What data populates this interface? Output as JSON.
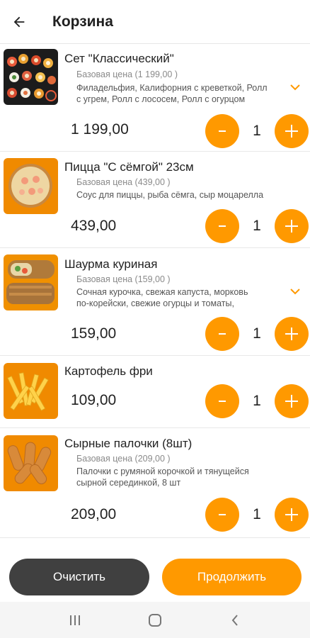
{
  "header": {
    "title": "Корзина"
  },
  "items": [
    {
      "name": "Сет \"Классический\"",
      "base_price": "Базовая цена (1 199,00 )",
      "description": "Филадельфия, Калифорния с креветкой, Ролл с угрем, Ролл с лососем, Ролл с огурцом",
      "description_lines": [
        "Филадельфия, Калифорния с креветкой, Ролл",
        "с угрем, Ролл с лососем, Ролл с огурцом"
      ],
      "price": "1 199,00",
      "quantity": "1",
      "minus_label": "-",
      "plus_label": "+"
    },
    {
      "name": "Пицца \"С сёмгой\" 23см",
      "base_price": "Базовая цена (439,00 )",
      "description": "Соус для пиццы, рыба сёмга, сыр моцарелла",
      "price": "439,00",
      "quantity": "1",
      "minus_label": "-",
      "plus_label": "+"
    },
    {
      "name": "Шаурма куриная",
      "base_price": "Базовая цена (159,00 )",
      "description_lines": [
        "Сочная курочка, свежая капуста, морковь",
        "по-корейски, свежие огурцы и томаты,"
      ],
      "price": "159,00",
      "quantity": "1",
      "minus_label": "-",
      "plus_label": "+"
    },
    {
      "name": "Картофель фри",
      "price": "109,00",
      "quantity": "1",
      "minus_label": "-",
      "plus_label": "+"
    },
    {
      "name": "Сырные палочки (8шт)",
      "base_price": "Базовая цена (209,00 )",
      "description_lines": [
        "Палочки с румяной корочкой и тянущейся",
        "сырной серединкой, 8 шт"
      ],
      "price": "209,00",
      "quantity": "1",
      "minus_label": "-",
      "plus_label": "+"
    }
  ],
  "actions": {
    "clear_label": "Очистить",
    "continue_label": "Продолжить"
  },
  "colors": {
    "accent": "#ff9900",
    "dark_button": "#404040"
  },
  "icons": {
    "back": "arrow-left-icon",
    "expand": "chevron-down-icon",
    "nav_recents": "recents-icon",
    "nav_home": "home-icon",
    "nav_back": "nav-back-icon"
  }
}
